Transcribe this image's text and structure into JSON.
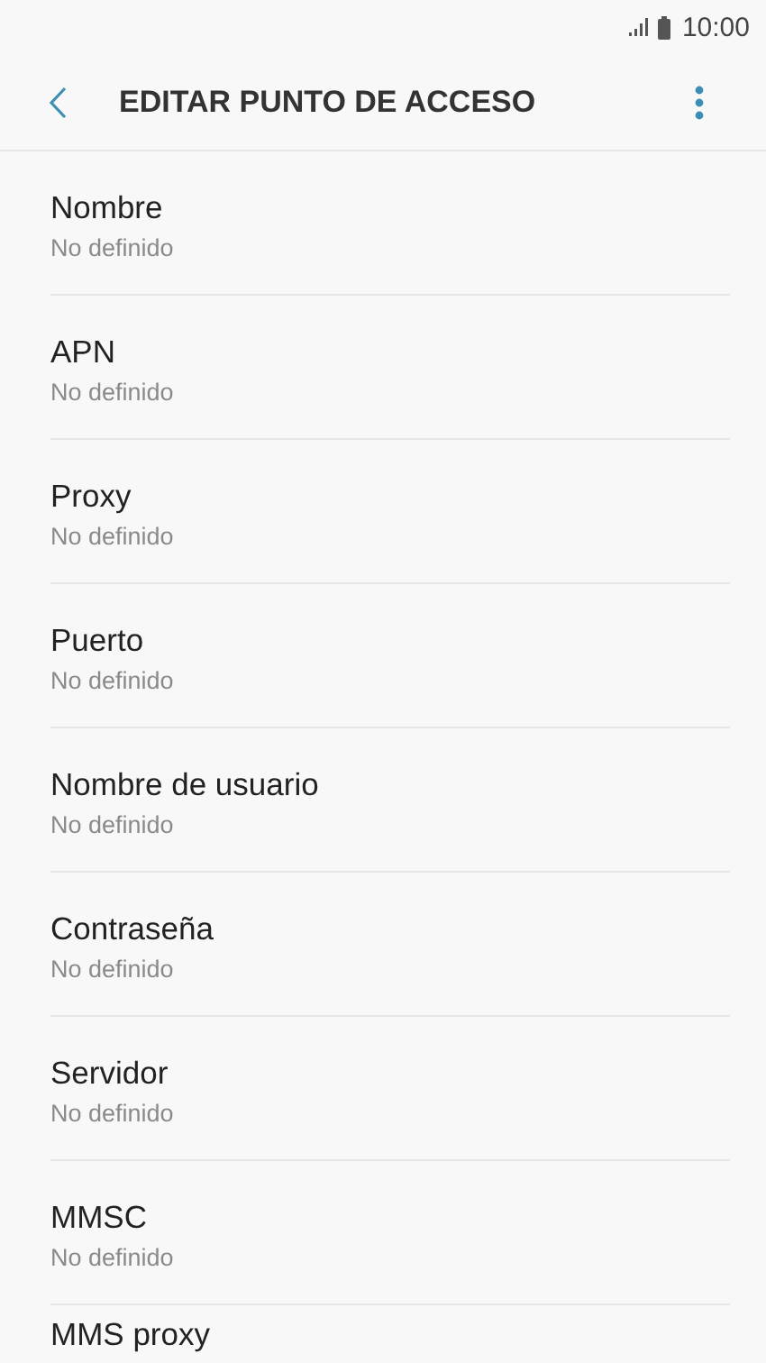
{
  "status_bar": {
    "time": "10:00"
  },
  "toolbar": {
    "title": "EDITAR PUNTO DE ACCESO"
  },
  "settings": [
    {
      "label": "Nombre",
      "value": "No definido"
    },
    {
      "label": "APN",
      "value": "No definido"
    },
    {
      "label": "Proxy",
      "value": "No definido"
    },
    {
      "label": "Puerto",
      "value": "No definido"
    },
    {
      "label": "Nombre de usuario",
      "value": "No definido"
    },
    {
      "label": "Contraseña",
      "value": "No definido"
    },
    {
      "label": "Servidor",
      "value": "No definido"
    },
    {
      "label": "MMSC",
      "value": "No definido"
    },
    {
      "label": "MMS proxy"
    }
  ]
}
